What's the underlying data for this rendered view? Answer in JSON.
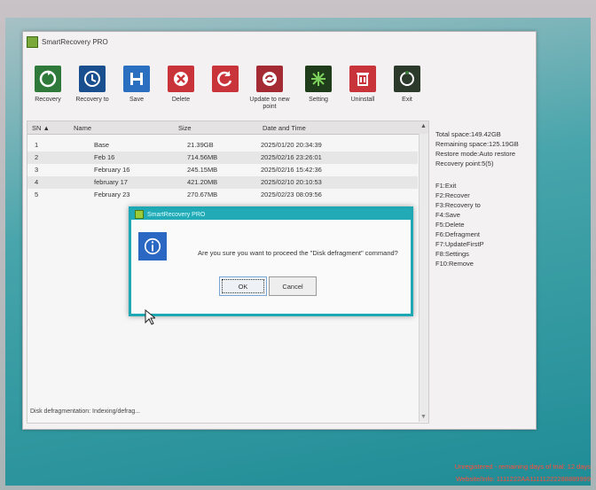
{
  "window": {
    "title": "SmartRecovery PRO"
  },
  "toolbar": {
    "buttons": [
      {
        "label": "Recovery",
        "icon": "recovery-icon",
        "color": "#2f7a3a"
      },
      {
        "label": "Recovery to",
        "icon": "recovery-to-icon",
        "color": "#1a4f8f"
      },
      {
        "label": "Save",
        "icon": "save-icon",
        "color": "#2a6fc0"
      },
      {
        "label": "Delete",
        "icon": "delete-icon",
        "color": "#c9343a"
      },
      {
        "label": "",
        "icon": "restore-icon",
        "color": "#c9343a"
      },
      {
        "label": "Update to new point",
        "icon": "update-icon",
        "color": "#a42b33"
      },
      {
        "label": "Setting",
        "icon": "setting-icon",
        "color": "#2f6a2a"
      },
      {
        "label": "Uninstall",
        "icon": "uninstall-icon",
        "color": "#c9343a"
      },
      {
        "label": "Exit",
        "icon": "exit-icon",
        "color": "#3a7a3a"
      }
    ]
  },
  "list": {
    "headers": [
      "SN ▲",
      "Name",
      "Size",
      "Date and Time"
    ],
    "rows": [
      {
        "sn": "1",
        "name": "Base",
        "size": "21.39GB",
        "date": "2025/01/20 20:34:39"
      },
      {
        "sn": "2",
        "name": "Feb 16",
        "size": "714.56MB",
        "date": "2025/02/16 23:26:01"
      },
      {
        "sn": "3",
        "name": "February 16",
        "size": "245.15MB",
        "date": "2025/02/16 15:42:36"
      },
      {
        "sn": "4",
        "name": "february 17",
        "size": "421.20MB",
        "date": "2025/02/10 20:10:53"
      },
      {
        "sn": "5",
        "name": "February 23",
        "size": "270.67MB",
        "date": "2025/02/23 08:09:56"
      }
    ],
    "status": "Disk defragmentation: Indexing/defrag..."
  },
  "info": {
    "lines": [
      "Total space:149.42GB",
      "Remaining space:125.19GB",
      "Restore mode:Auto restore",
      "Recovery point:5(5)"
    ],
    "shortcuts": [
      "F1:Exit",
      "F2:Recover",
      "F3:Recovery to",
      "F4:Save",
      "F5:Delete",
      "F6:Defragment",
      "F7:UpdateFirstP",
      "F8:Settings",
      "F10:Remove"
    ]
  },
  "dialog": {
    "title": "SmartRecovery PRO",
    "message": "Are you sure you want to proceed the \"Disk defragment\" command?",
    "ok": "OK",
    "cancel": "Cancel"
  },
  "watermark": {
    "line1": "Unregistered - remaining days of trial: 12 days",
    "line2": "Website/Info: 1111222AA11111222288889999"
  }
}
